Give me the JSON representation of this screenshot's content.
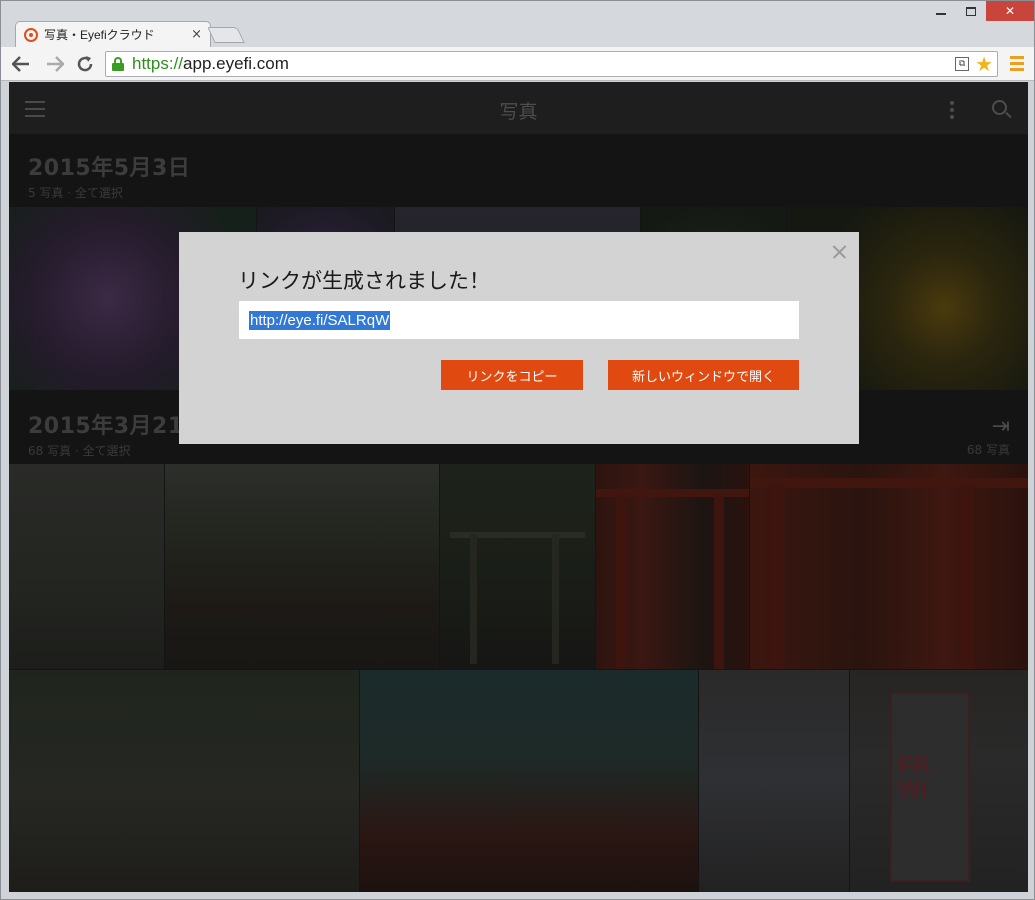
{
  "browser": {
    "tab_title": "写真・Eyefiクラウド",
    "tab_close": "×",
    "url_scheme": "https://",
    "url_host": "app.eyefi.com",
    "back_icon": "arrow-left-icon",
    "forward_icon": "arrow-right-icon",
    "reload_icon": "reload-icon"
  },
  "window_controls": {
    "close_glyph": "✕"
  },
  "app": {
    "title": "写真"
  },
  "sections": [
    {
      "date": "2015年5月3日",
      "subtitle": "5 写真 · 全て選択"
    },
    {
      "date": "2015年3月21日",
      "subtitle": "68 写真 · 全て選択",
      "count": "68 写真"
    }
  ],
  "dialog": {
    "title": "リンクが生成されました！",
    "link_value": "http://eye.fi/SALRqW",
    "copy_label": "リンクをコピー",
    "open_label": "新しいウィンドウで開く"
  },
  "colors": {
    "accent": "#e04a10",
    "selection": "#3179d5",
    "url_green": "#2f8f1d"
  }
}
